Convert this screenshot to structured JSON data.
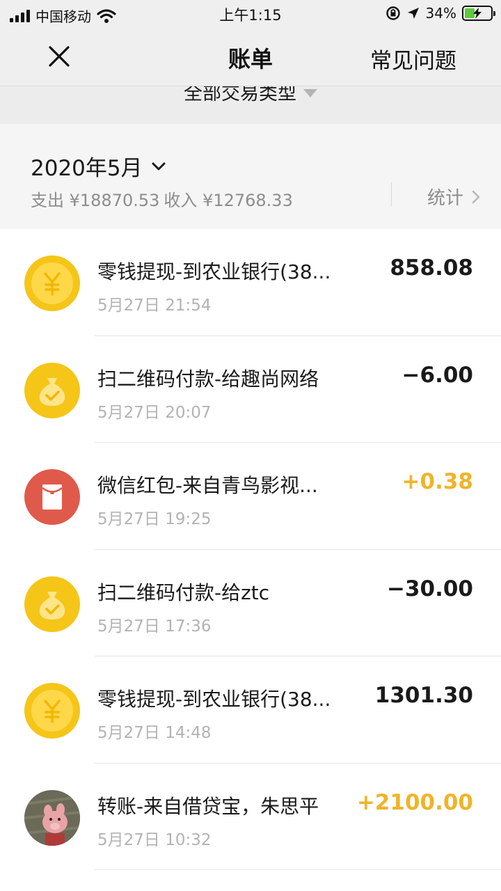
{
  "status_bar": {
    "carrier": "中国移动",
    "time": "上午1:15",
    "battery_percent": "34%",
    "battery_level": 0.34,
    "icons": [
      "signal-icon",
      "wifi-icon",
      "orientation-lock-icon",
      "location-icon",
      "battery-charging-icon"
    ]
  },
  "nav": {
    "close_icon": "close-icon",
    "title": "账单",
    "faq_label": "常见问题"
  },
  "filter": {
    "label": "全部交易类型",
    "caret_icon": "caret-down-icon"
  },
  "summary": {
    "month": "2020年5月",
    "expense": "支出 ¥18870.53",
    "income": "收入 ¥12768.33",
    "stats_label": "统计"
  },
  "colors": {
    "gold": "#f5c518",
    "red_packet": "#e05a4b",
    "income_amount": "#f0b429"
  },
  "transactions": [
    {
      "icon": "yuan-coin-icon",
      "title": "零钱提现-到农业银行(38...",
      "time": "5月27日 21:54",
      "amount": "858.08",
      "type": "neutral"
    },
    {
      "icon": "money-bag-icon",
      "title": "扫二维码付款-给趣尚网络",
      "time": "5月27日 20:07",
      "amount": "−6.00",
      "type": "expense"
    },
    {
      "icon": "red-packet-icon",
      "title": "微信红包-来自青鸟影视...",
      "time": "5月27日 19:25",
      "amount": "+0.38",
      "type": "income"
    },
    {
      "icon": "money-bag-icon",
      "title": "扫二维码付款-给ztc",
      "time": "5月27日 17:36",
      "amount": "−30.00",
      "type": "expense"
    },
    {
      "icon": "yuan-coin-icon",
      "title": "零钱提现-到农业银行(38...",
      "time": "5月27日 14:48",
      "amount": "1301.30",
      "type": "neutral"
    },
    {
      "icon": "avatar-icon",
      "title": "转账-来自借贷宝，朱思平",
      "time": "5月27日 10:32",
      "amount": "+2100.00",
      "type": "income"
    }
  ]
}
